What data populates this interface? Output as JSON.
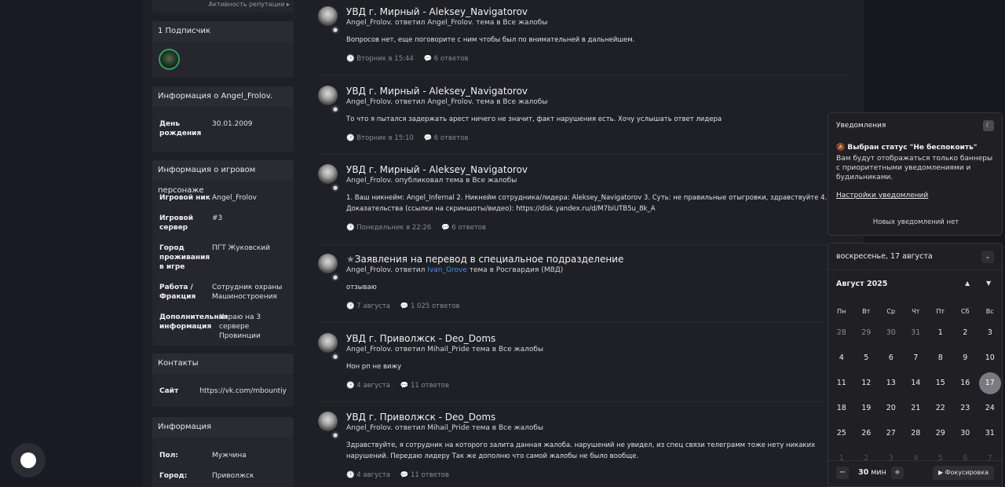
{
  "sidebar": {
    "reputation_link": "Активность репутации ▸",
    "followers_title": "1 Подписчик",
    "info_title": "Информация о Angel_Frolov.",
    "birthday_key": "День рождения",
    "birthday_val": "30.01.2009",
    "game_title": "Информация о игровом персонаже",
    "game": [
      {
        "k": "Игровой ник",
        "v": "Angel_Frolov"
      },
      {
        "k": "Игровой сервер",
        "v": "#3"
      },
      {
        "k": "Город проживания в игре",
        "v": "ПГТ Жуковский"
      },
      {
        "k": "Работа / Фракция",
        "v": "Сотрудник охраны Машиностроения"
      },
      {
        "k": "Дополнительная информация",
        "v": "Играю на 3 сервере Провинции"
      }
    ],
    "contacts_title": "Контакты",
    "site_key": "Сайт",
    "site_val": "https://vk.com/mbountiy",
    "about_title": "Информация",
    "gender_key": "Пол:",
    "gender_val": "Мужчина",
    "city_key": "Город:",
    "city_val": "Приволжск"
  },
  "posts": [
    {
      "title": "УВД г. Мирный - Aleksey_Navigatorov",
      "sub": "Angel_Frolov. ответил Angel_Frolov. тема в Все жалобы",
      "text": "Вопросов нет, еще поговорите с ним чтобы был по внимательней в дальнейшем.",
      "date": "🕑 Вторник в 15:44",
      "replies": "💬 6 ответов"
    },
    {
      "title": "УВД г. Мирный - Aleksey_Navigatorov",
      "sub": "Angel_Frolov. ответил Angel_Frolov. тема в Все жалобы",
      "text": "То что я пытался задержать арест ничего не значит, факт нарушения есть. Хочу услышать ответ лидера",
      "date": "🕑 Вторник в 15:10",
      "replies": "💬 6 ответов"
    },
    {
      "title": "УВД г. Мирный - Aleksey_Navigatorov",
      "sub": "Angel_Frolov. опубликовал тема в Все жалобы",
      "text": "1. Ваш никнейм: Angel_Infernal 2. Никнейм сотрудника/лидера: Aleksey_Navigatorov 3. Суть: не правильные отыгровки, здравствуйте 4. Доказательства (ссылки на скриншоты/видео): https://disk.yandex.ru/d/M7biUTB5u_8k_A",
      "date": "🕑 Понедельник в 22:26",
      "replies": "💬 6 ответов"
    },
    {
      "title": "Заявления на перевод в специальное подразделение",
      "star": "★",
      "sub_a": "Angel_Frolov. ответил ",
      "sub_link": "Ivan_Grove",
      "sub_b": " тема в Росгвардия (МВД)",
      "text": "отзываю",
      "date": "🕑 7 августа",
      "replies": "💬 1 025 ответов"
    },
    {
      "title": "УВД г. Приволжск - Deo_Doms",
      "sub": "Angel_Frolov. ответил Mihail_Pride тема в Все жалобы",
      "text": "Нон рп не вижу",
      "date": "🕑 4 августа",
      "replies": "💬 11 ответов"
    },
    {
      "title": "УВД г. Приволжск - Deo_Doms",
      "sub": "Angel_Frolov. ответил Mihail_Pride тема в Все жалобы",
      "text": "Здравствуйте, я сотрудник на которого залита данная жалоба. нарушений не увидел, из спец связи телеграмм тоже нету никаких нарушений. Передаю лидеру Так же дополню что самой жалобы не было вообще.",
      "date": "🕑 4 августа",
      "replies": "💬 11 ответов"
    }
  ],
  "notifications": {
    "title": "Уведомления",
    "status": "Выбран статус \"Не беспокоить\"",
    "description": "Вам будут отображаться только баннеры с приоритетными уведомлениями и будильниками.",
    "settings_link": "Настройки уведомлений",
    "empty": "Новых уведомлений нет"
  },
  "calendar": {
    "selected_date": "воскресенье, 17 августа",
    "month": "Август 2025",
    "weekdays": [
      "Пн",
      "Вт",
      "Ср",
      "Чт",
      "Пт",
      "Сб",
      "Вс"
    ],
    "weeks": [
      [
        "28",
        "29",
        "30",
        "31",
        "1",
        "2",
        "3"
      ],
      [
        "4",
        "5",
        "6",
        "7",
        "8",
        "9",
        "10"
      ],
      [
        "11",
        "12",
        "13",
        "14",
        "15",
        "16",
        "17"
      ],
      [
        "18",
        "19",
        "20",
        "21",
        "22",
        "23",
        "24"
      ],
      [
        "25",
        "26",
        "27",
        "28",
        "29",
        "30",
        "31"
      ],
      [
        "1",
        "2",
        "3",
        "4",
        "5",
        "6",
        "7"
      ]
    ],
    "today": "17",
    "focus_minutes": "30",
    "focus_unit": "мин",
    "focus_button": "▶ Фокусировка"
  }
}
